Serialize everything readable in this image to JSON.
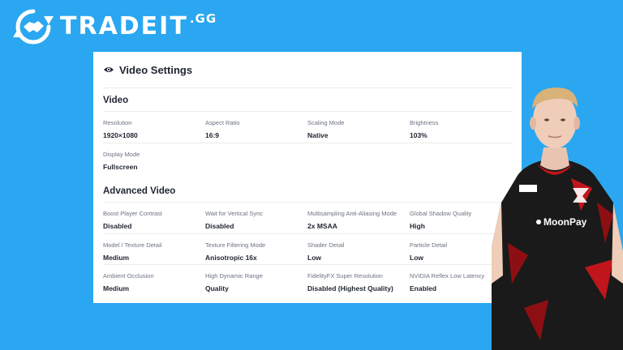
{
  "brand": {
    "name": "TRADEIT",
    "suffix": ".GG"
  },
  "panel": {
    "icon": "eye-icon",
    "title": "Video Settings",
    "sections": [
      {
        "title": "Video",
        "settings": [
          {
            "label": "Resolution",
            "value": "1920×1080"
          },
          {
            "label": "Aspect Ratio",
            "value": "16:9"
          },
          {
            "label": "Scaling Mode",
            "value": "Native"
          },
          {
            "label": "Brightness",
            "value": "103%"
          },
          {
            "label": "Display Mode",
            "value": "Fullscreen"
          }
        ]
      },
      {
        "title": "Advanced Video",
        "settings": [
          {
            "label": "Boost Player Contrast",
            "value": "Disabled"
          },
          {
            "label": "Wait for Vertical Sync",
            "value": "Disabled"
          },
          {
            "label": "Multisampling Anti-Aliasing Mode",
            "value": "2x MSAA"
          },
          {
            "label": "Global Shadow Quality",
            "value": "High"
          },
          {
            "label": "Model / Texture Detail",
            "value": "Medium"
          },
          {
            "label": "Texture Filtering Mode",
            "value": "Anisotropic 16x"
          },
          {
            "label": "Shader Detail",
            "value": "Low"
          },
          {
            "label": "Particle Detail",
            "value": "Low"
          },
          {
            "label": "Ambient Occlusion",
            "value": "Medium"
          },
          {
            "label": "High Dynamic Range",
            "value": "Quality"
          },
          {
            "label": "FidelityFX Super Resolution",
            "value": "Disabled (Highest Quality)"
          },
          {
            "label": "NVIDIA Reflex Low Latency",
            "value": "Enabled"
          }
        ]
      }
    ]
  },
  "player": {
    "jersey_sponsor": "MoonPay"
  },
  "colors": {
    "background": "#2aa7f0",
    "panel": "#ffffff",
    "text": "#1f2430",
    "label": "#6b7280",
    "jersey": "#1a1a1a",
    "jersey_accent": "#c0161b"
  }
}
